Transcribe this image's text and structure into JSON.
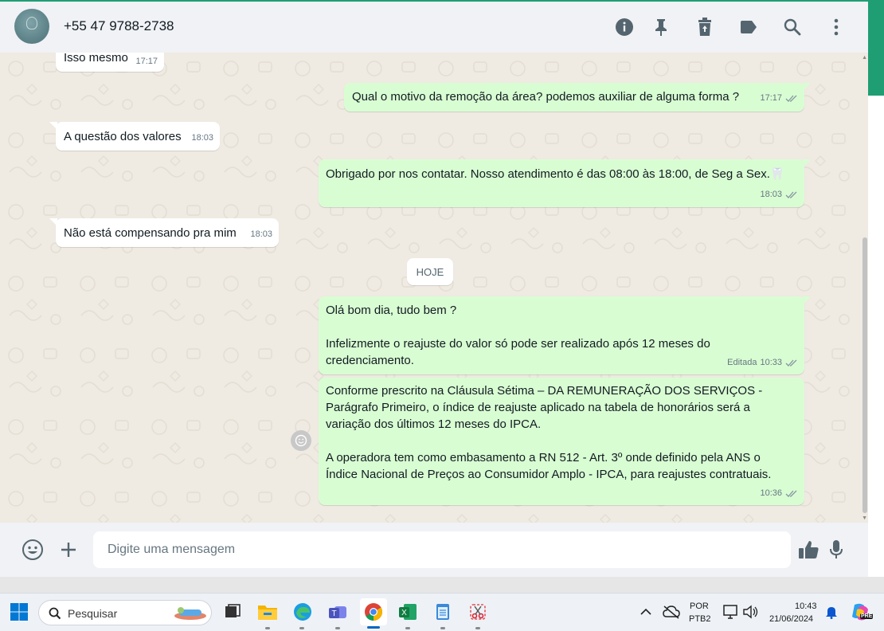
{
  "header": {
    "contact_name": "+55 47 9788-2738",
    "icons": [
      "info-icon",
      "pin-icon",
      "delete-icon",
      "label-icon",
      "search-icon",
      "menu-icon"
    ]
  },
  "messages": [
    {
      "dir": "in",
      "text": "Isso mesmo",
      "time": "17:17"
    },
    {
      "dir": "out",
      "text": "Qual o motivo da remoção da área? podemos auxiliar de alguma forma ?",
      "time": "17:17"
    },
    {
      "dir": "in",
      "text": "A questão dos valores",
      "time": "18:03"
    },
    {
      "dir": "out",
      "text": "Obrigado por nos contatar. Nosso atendimento é das 08:00 às 18:00, de Seg a Sex.",
      "emoji": "🦷",
      "time": "18:03"
    },
    {
      "dir": "in",
      "text": "Não está compensando pra mim",
      "time": "18:03"
    },
    {
      "dir": "out",
      "text": "Olá bom dia, tudo bem ?\n\nInfelizmente o reajuste do valor só pode ser realizado após 12 meses do credenciamento.",
      "edited": "Editada",
      "time": "10:33"
    },
    {
      "dir": "out",
      "text": "Conforme prescrito na Cláusula Sétima – DA REMUNERAÇÃO DOS SERVIÇOS - Parágrafo Primeiro, o índice de reajuste aplicado na tabela de honorários será a variação dos últimos 12 meses do IPCA.\n\nA operadora tem como embasamento a RN 512 - Art. 3º onde definido pela ANS o Índice Nacional de Preços ao Consumidor Amplo - IPCA, para reajustes contratuais.",
      "time": "10:36"
    }
  ],
  "day_separator": "HOJE",
  "composer": {
    "placeholder": "Digite uma mensagem"
  },
  "taskbar": {
    "search_placeholder": "Pesquisar",
    "language": "POR",
    "keyboard": "PTB2",
    "time": "10:43",
    "date": "21/06/2024",
    "copilot_badge": "PRE"
  },
  "colors": {
    "accent": "#1f9e74",
    "outgoing_bubble": "#d9fdd3",
    "incoming_bubble": "#ffffff",
    "chat_bg": "#efeae2",
    "read_ticks": "#8696a0"
  }
}
